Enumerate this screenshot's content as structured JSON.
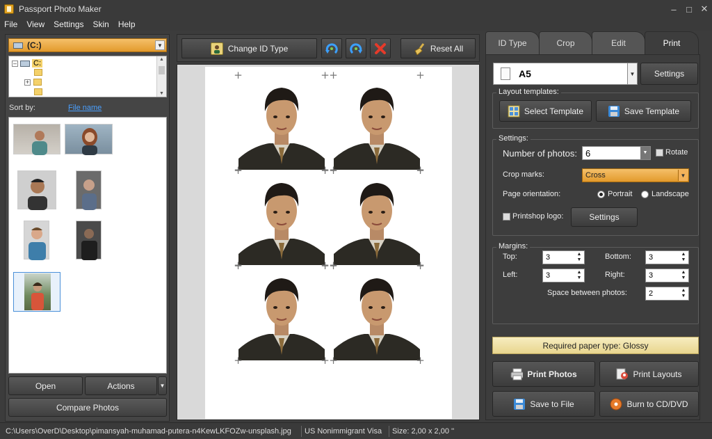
{
  "window": {
    "title": "Passport Photo Maker"
  },
  "menu": [
    "File",
    "View",
    "Settings",
    "Skin",
    "Help"
  ],
  "left": {
    "drive": "(C:)",
    "tree_root": "C:",
    "sort_by_label": "Sort by:",
    "sort_link": "File name",
    "open_label": "Open",
    "actions_label": "Actions",
    "compare_label": "Compare Photos"
  },
  "toolbar": {
    "change_id_label": "Change ID Type",
    "reset_label": "Reset All"
  },
  "tabs": [
    "ID Type",
    "Crop",
    "Edit",
    "Print"
  ],
  "active_tab": "Print",
  "print": {
    "paper_size": "A5",
    "settings_label": "Settings",
    "layout_templates_title": "Layout templates:",
    "select_template_label": "Select Template",
    "save_template_label": "Save Template",
    "settings_group_title": "Settings:",
    "num_photos_label": "Number of photos:",
    "num_photos_value": "6",
    "rotate_label": "Rotate",
    "crop_marks_label": "Crop marks:",
    "crop_marks_value": "Cross",
    "orientation_label": "Page orientation:",
    "portrait_label": "Portrait",
    "landscape_label": "Landscape",
    "printshop_label": "Printshop logo:",
    "printshop_settings_label": "Settings",
    "margins_title": "Margins:",
    "top_label": "Top:",
    "top_value": "3",
    "bottom_label": "Bottom:",
    "bottom_value": "3",
    "left_label": "Left:",
    "left_value": "3",
    "right_label": "Right:",
    "right_value": "3",
    "space_label": "Space between photos:",
    "space_value": "2",
    "paper_type": "Required paper type: Glossy",
    "print_photos_label": "Print Photos",
    "print_layouts_label": "Print Layouts",
    "save_file_label": "Save to File",
    "burn_label": "Burn to CD/DVD"
  },
  "status": {
    "path": "C:\\Users\\OverD\\Desktop\\pimansyah-muhamad-putera-n4KewLKFOZw-unsplash.jpg",
    "id_type": "US Nonimmigrant Visa",
    "size": "Size: 2,00 x 2,00 ''"
  },
  "colors": {
    "accent_orange": "#e39a2c",
    "link_blue": "#4aa0ff",
    "panel_dark": "#3d3d3d"
  }
}
